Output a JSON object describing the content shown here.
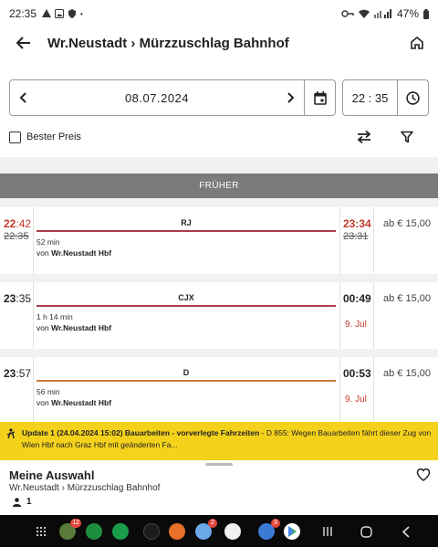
{
  "status_bar": {
    "time": "22:35",
    "battery": "47%"
  },
  "header": {
    "title": "Wr.Neustadt › Mürzzuschlag Bahnhof"
  },
  "search": {
    "date": "08.07.2024",
    "time": "22 : 35",
    "best_price_label": "Bester Preis"
  },
  "earlier_label": "FRÜHER",
  "connections": [
    {
      "dep_time_hour": "22",
      "dep_time_min": ":42",
      "dep_scheduled": "22:35",
      "dep_delayed": true,
      "product": "RJ",
      "line_color": "#b03a48",
      "duration": "52 min",
      "from_prefix": "von ",
      "from_station": "Wr.Neustadt Hbf",
      "arr_time_hour": "23",
      "arr_time_min": ":34",
      "arr_scheduled": "23:31",
      "arr_delayed": true,
      "arr_day": "",
      "price": "ab € 15,00"
    },
    {
      "dep_time_hour": "23",
      "dep_time_min": ":35",
      "dep_scheduled": "",
      "dep_delayed": false,
      "product": "CJX",
      "line_color": "#b03a48",
      "duration": "1 h 14 min",
      "from_prefix": "von ",
      "from_station": "Wr.Neustadt Hbf",
      "arr_time_hour": "00",
      "arr_time_min": ":49",
      "arr_scheduled": "",
      "arr_delayed": false,
      "arr_day": "9. Jul",
      "price": "ab € 15,00"
    },
    {
      "dep_time_hour": "23",
      "dep_time_min": ":57",
      "dep_scheduled": "",
      "dep_delayed": false,
      "product": "D",
      "line_color": "#c77a3a",
      "duration": "56 min",
      "from_prefix": "von ",
      "from_station": "Wr.Neustadt Hbf",
      "arr_time_hour": "00",
      "arr_time_min": ":53",
      "arr_scheduled": "",
      "arr_delayed": false,
      "arr_day": "9. Jul",
      "price": "ab € 15,00"
    }
  ],
  "notice": {
    "headline": "Update 1 (24.04.2024 15:02) Bauarbeiten - vorverlegte Fahrzeiten",
    "body": " - D 855: Wegen Bauarbeiten fährt dieser Zug von Wien Hbf nach Graz Hbf mit geänderten Fa..."
  },
  "selection": {
    "title": "Meine Auswahl",
    "route": "Wr.Neustadt › Mürzzuschlag Bahnhof",
    "passengers": "1"
  },
  "nav": {
    "badges": [
      "12",
      "2",
      "3"
    ]
  },
  "colors": {
    "delay_red": "#c0392b",
    "notice_yellow": "#f4d21c",
    "earlier_bar": "#7a7a7a"
  }
}
